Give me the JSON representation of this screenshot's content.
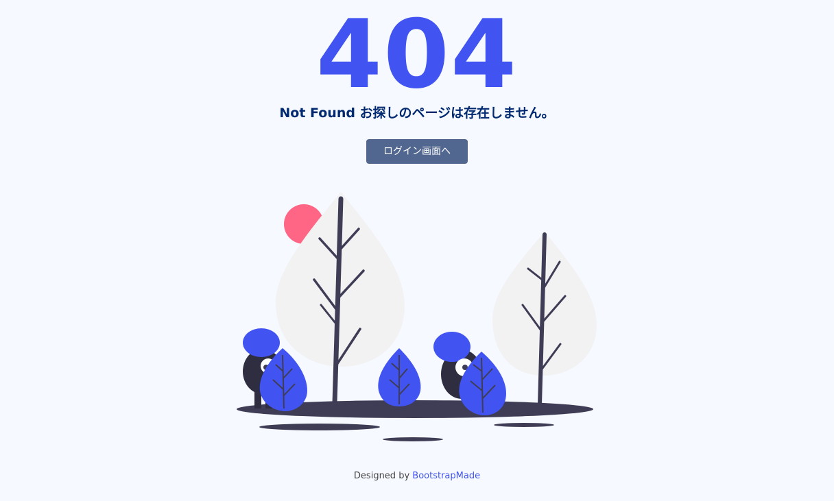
{
  "error": {
    "code": "404",
    "message": "Not Found お探しのページは存在しません。"
  },
  "actions": {
    "login_label": "ログイン画面へ"
  },
  "credits": {
    "prefix": "Designed by",
    "link_text": "BootstrapMade"
  },
  "colors": {
    "accent": "#4154f1",
    "heading": "#012970",
    "button_bg": "#51678f",
    "background": "#f6f9ff",
    "sun": "#ff6584",
    "ground": "#3f3d56",
    "tree": "#f2f2f2"
  },
  "illustration": {
    "name": "not-found-illustration"
  }
}
